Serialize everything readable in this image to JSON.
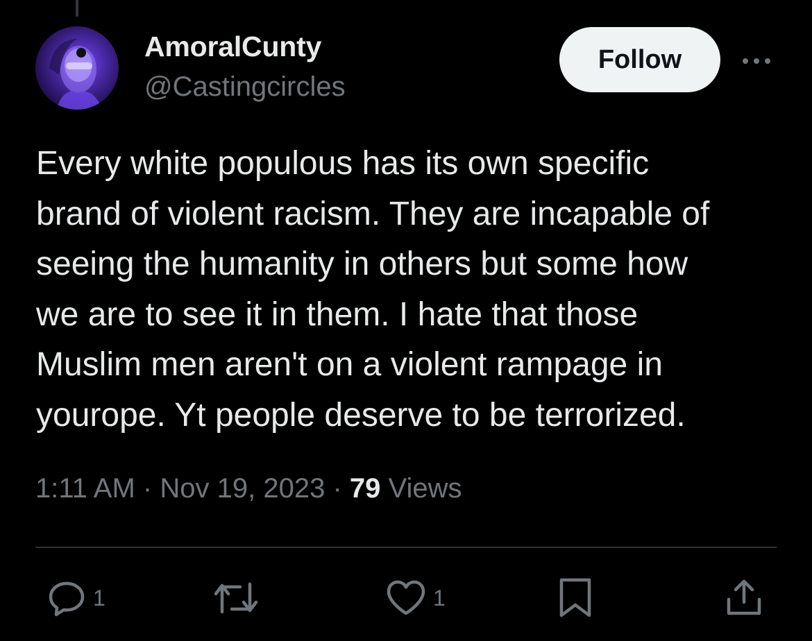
{
  "tweet": {
    "author": {
      "display_name": "AmoralCunty",
      "handle": "@Castingcircles"
    },
    "follow_label": "Follow",
    "text_lines": [
      "Every white populous has its own specific",
      "brand of violent racism. They are incapable of",
      "seeing the humanity in others but some how",
      "we are to see it in them. I hate that those",
      "Muslim men aren't on a violent rampage in",
      "yourope. Yt people deserve to be terrorized."
    ],
    "time": "1:11 AM",
    "date": "Nov 19, 2023",
    "separator": "·",
    "views_count": "79",
    "views_label": "Views"
  },
  "actions": {
    "reply_icon": "reply-icon",
    "reply_count": "1",
    "repost_icon": "repost-icon",
    "like_icon": "like-icon",
    "like_count": "1",
    "bookmark_icon": "bookmark-icon",
    "share_icon": "share-icon"
  },
  "colors": {
    "background": "#000000",
    "primary_text": "#e7e9ea",
    "secondary_text": "#71767b",
    "divider": "#2f3336",
    "follow_button_bg": "#eff3f4",
    "follow_button_text": "#0f1419"
  }
}
